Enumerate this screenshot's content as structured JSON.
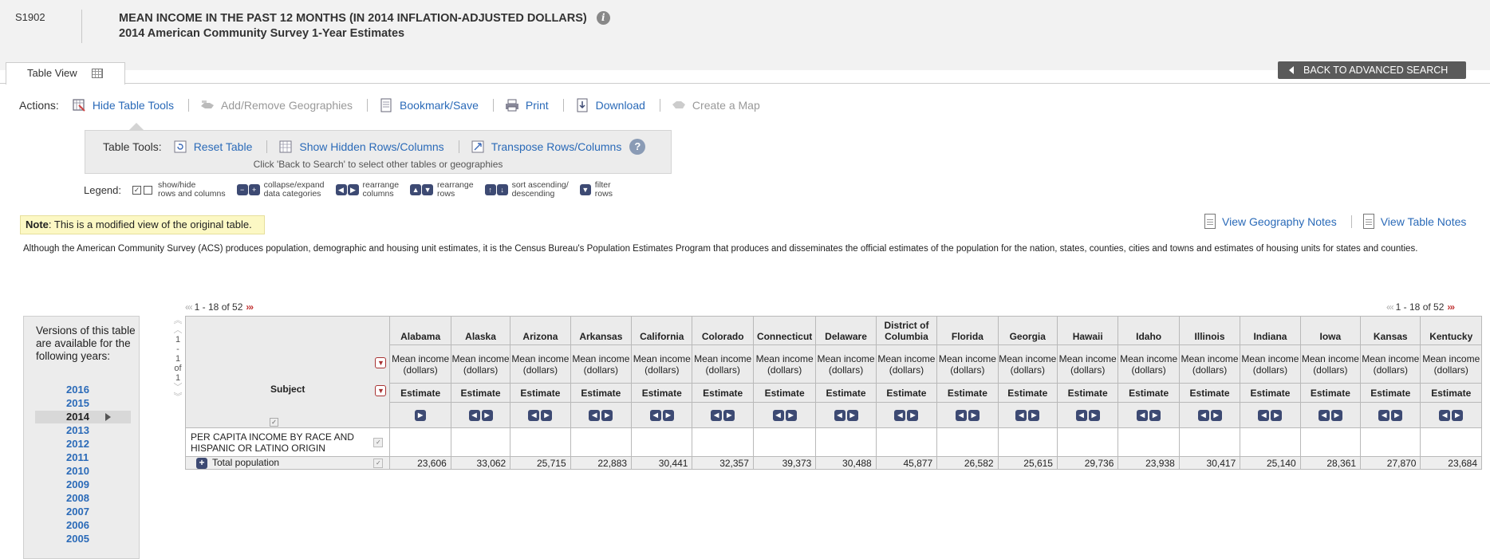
{
  "header": {
    "table_id": "S1902",
    "title": "MEAN INCOME IN THE PAST 12 MONTHS (IN 2014 INFLATION-ADJUSTED DOLLARS)",
    "subtitle": "2014 American Community Survey 1-Year Estimates",
    "info_icon": "i"
  },
  "tab": {
    "label": "Table View"
  },
  "back_button": {
    "label": "BACK TO ADVANCED SEARCH"
  },
  "actions": {
    "label": "Actions:",
    "items": [
      {
        "label": "Hide Table Tools",
        "icon": "table-tools-icon",
        "enabled": true
      },
      {
        "label": "Add/Remove Geographies",
        "icon": "geographies-icon",
        "enabled": false
      },
      {
        "label": "Bookmark/Save",
        "icon": "bookmark-icon",
        "enabled": true
      },
      {
        "label": "Print",
        "icon": "print-icon",
        "enabled": true
      },
      {
        "label": "Download",
        "icon": "download-icon",
        "enabled": true
      },
      {
        "label": "Create a Map",
        "icon": "map-icon",
        "enabled": false
      }
    ]
  },
  "table_tools": {
    "label": "Table Tools:",
    "items": [
      {
        "label": "Reset Table"
      },
      {
        "label": "Show Hidden Rows/Columns"
      },
      {
        "label": "Transpose Rows/Columns"
      }
    ],
    "help": "?",
    "note": "Click 'Back to Search' to select other tables or geographies"
  },
  "legend": {
    "label": "Legend:",
    "items": [
      {
        "line1": "show/hide",
        "line2": "rows and columns"
      },
      {
        "line1": "collapse/expand",
        "line2": "data categories"
      },
      {
        "line1": "rearrange",
        "line2": "columns"
      },
      {
        "line1": "rearrange",
        "line2": "rows"
      },
      {
        "line1": "sort ascending/",
        "line2": "descending"
      },
      {
        "line1": "filter",
        "line2": "rows"
      }
    ]
  },
  "note": {
    "prefix": "Note",
    "text": ": This is a modified view of the original table."
  },
  "notes_links": {
    "geography": "View Geography Notes",
    "table": "View Table Notes"
  },
  "disclaimer": "Although the American Community Survey (ACS) produces population, demographic and housing unit estimates, it is the Census Bureau's Population Estimates Program that produces and disseminates the official estimates of the population for the nation, states, counties, cities and towns and estimates of housing units for states and counties.",
  "versions": {
    "text": "Versions of this table are available for the following years:",
    "years": [
      "2016",
      "2015",
      "2014",
      "2013",
      "2012",
      "2011",
      "2010",
      "2009",
      "2008",
      "2007",
      "2006",
      "2005"
    ],
    "selected": "2014"
  },
  "pager": {
    "text": "1 - 18 of 52"
  },
  "vnav": {
    "page": "1",
    "dash": "-",
    "to": "1",
    "of": "of",
    "total": "1"
  },
  "table": {
    "subject_header": "Subject",
    "measure": "Mean income (dollars)",
    "estimate": "Estimate",
    "states": [
      "Alabama",
      "Alaska",
      "Arizona",
      "Arkansas",
      "California",
      "Colorado",
      "Connecticut",
      "Delaware",
      "District of Columbia",
      "Florida",
      "Georgia",
      "Hawaii",
      "Idaho",
      "Illinois",
      "Indiana",
      "Iowa",
      "Kansas",
      "Kentucky"
    ],
    "section_label": "PER CAPITA INCOME BY RACE AND HISPANIC OR LATINO ORIGIN",
    "row_label": "Total population",
    "values": [
      "23,606",
      "33,062",
      "25,715",
      "22,883",
      "30,441",
      "32,357",
      "39,373",
      "30,488",
      "45,877",
      "26,582",
      "25,615",
      "29,736",
      "23,938",
      "30,417",
      "25,140",
      "28,361",
      "27,870",
      "23,684"
    ]
  },
  "colors": {
    "link": "#2a6ab8",
    "button_dark": "#3d4a73",
    "note_bg": "#fcf8c4",
    "header_bg": "#f2f2f2"
  }
}
